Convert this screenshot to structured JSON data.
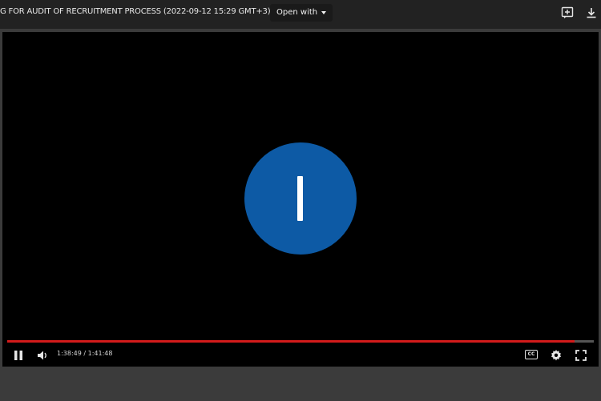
{
  "topbar": {
    "title": "G FOR AUDIT OF RECRUITMENT PROCESS (2022-09-12 15:29 GMT+3)",
    "open_with_label": "Open with",
    "icons": [
      "add-comment-icon",
      "download-icon"
    ]
  },
  "player": {
    "logo": "circle-i-logo",
    "time_display": "1:38:49 / 1:41:48",
    "progress_fraction": 0.967,
    "progress_color": "#d31b1b",
    "cc_label": "CC",
    "icons": [
      "play-pause-icon",
      "volume-icon",
      "closed-captions-icon",
      "settings-gear-icon",
      "fullscreen-icon"
    ]
  },
  "colors": {
    "topbar_bg": "#222222",
    "player_bg": "#000000",
    "logo_blue": "#0d5aa5"
  }
}
